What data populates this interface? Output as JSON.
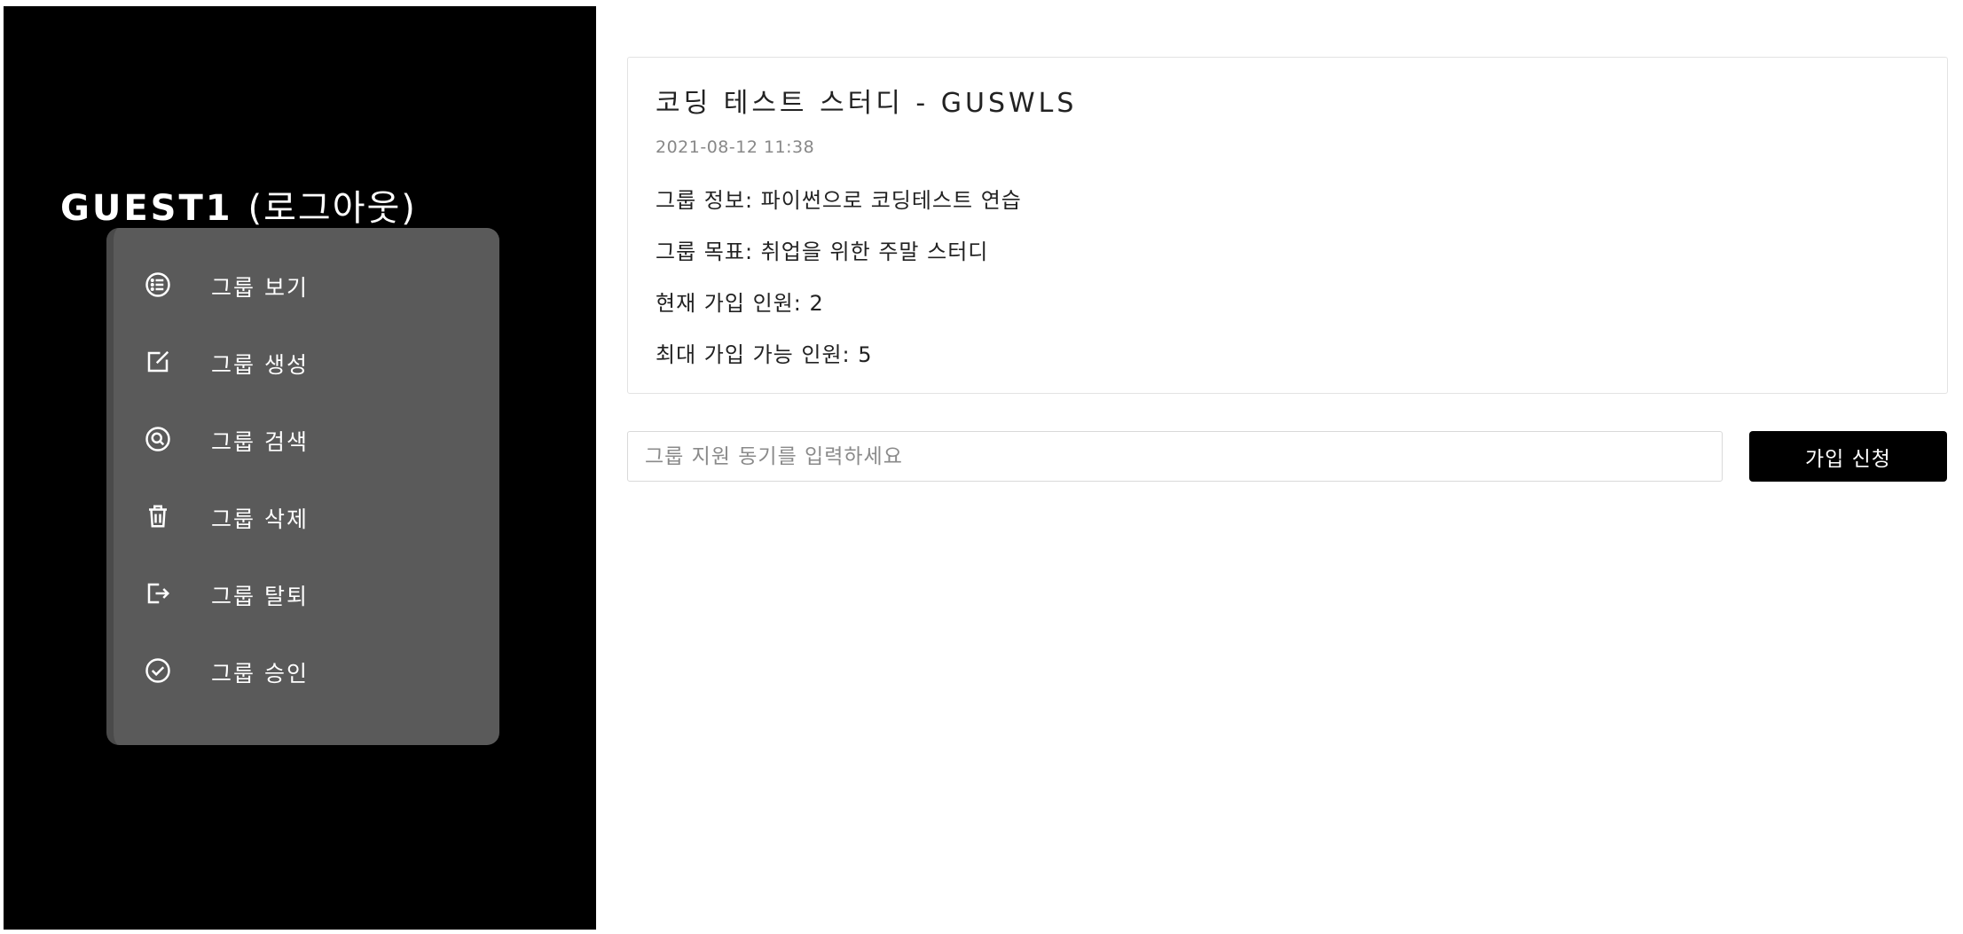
{
  "sidebar": {
    "username": "GUEST1",
    "logout_label": "(로그아웃)",
    "menu": [
      {
        "label": "그룹 보기",
        "icon": "list-icon"
      },
      {
        "label": "그룹 생성",
        "icon": "edit-icon"
      },
      {
        "label": "그룹 검색",
        "icon": "search-icon"
      },
      {
        "label": "그룹 삭제",
        "icon": "trash-icon"
      },
      {
        "label": "그룹 탈퇴",
        "icon": "logout-icon"
      },
      {
        "label": "그룹 승인",
        "icon": "check-circle-icon"
      }
    ]
  },
  "group": {
    "title": "코딩 테스트 스터디 - GUSWLS",
    "date": "2021-08-12 11:38",
    "info": "그룹 정보: 파이썬으로 코딩테스트 연습",
    "goal": "그룹 목표: 취업을 위한 주말 스터디",
    "current_members": "현재 가입 인원: 2",
    "max_members": "최대 가입 가능 인원: 5"
  },
  "apply": {
    "placeholder": "그룹 지원 동기를 입력하세요",
    "value": "",
    "button_label": "가입 신청"
  },
  "colors": {
    "sidebar_bg": "#000000",
    "menu_panel_bg": "#5a5a5a",
    "button_bg": "#000000"
  }
}
